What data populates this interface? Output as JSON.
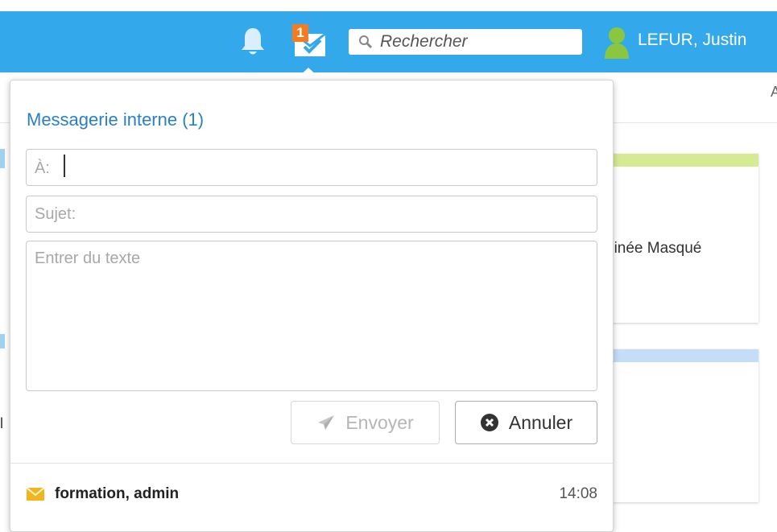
{
  "header": {
    "badge_count": "1",
    "search_placeholder": "Rechercher",
    "user_name": "LEFUR, Justin"
  },
  "background": {
    "corner_letter": "A",
    "card1_text": "ninée  Masqué",
    "left_fragment": "l"
  },
  "compose": {
    "title": "Messagerie interne (1)",
    "to_label": "À:",
    "to_value": "",
    "subject_placeholder": "Sujet:",
    "body_placeholder": "Entrer du texte",
    "send_label": "Envoyer",
    "cancel_label": "Annuler"
  },
  "messages": [
    {
      "sender": "formation, admin",
      "time": "14:08",
      "icon": "envelope-icon"
    }
  ],
  "colors": {
    "header_blue": "#33a9ec",
    "badge_orange": "#f47b20",
    "user_icon_green": "#8ac73e",
    "title_blue": "#2a7fc9",
    "envelope_yellow": "#f2b51e"
  }
}
